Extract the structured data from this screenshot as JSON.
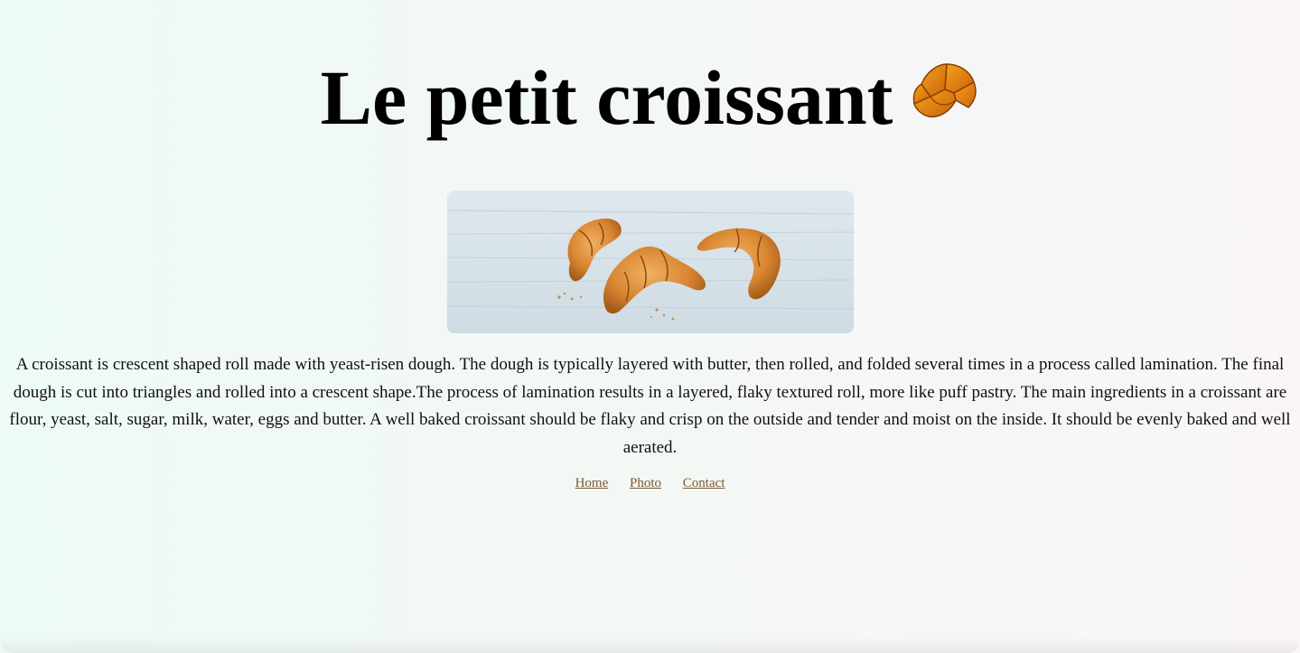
{
  "page": {
    "title": "Le petit croissant",
    "title_icon": "croissant-emoji",
    "hero_image": "three-croissants-on-white-wood",
    "description": "A croissant is crescent shaped roll made with yeast-risen dough. The dough is typically layered with butter, then rolled, and folded several times in a process called lamination. The final dough is cut into triangles and rolled into a crescent shape.The process of lamination results in a layered, flaky textured roll, more like puff pastry. The main ingredients in a croissant are flour, yeast, salt, sugar, milk, water, eggs and butter. A well baked croissant should be flaky and crisp on the outside and tender and moist on the inside. It should be evenly baked and well aerated."
  },
  "nav": {
    "links": [
      {
        "label": "Home"
      },
      {
        "label": "Photo"
      },
      {
        "label": "Contact"
      }
    ]
  },
  "colors": {
    "link": "#7a5a2e",
    "text": "#111111"
  }
}
